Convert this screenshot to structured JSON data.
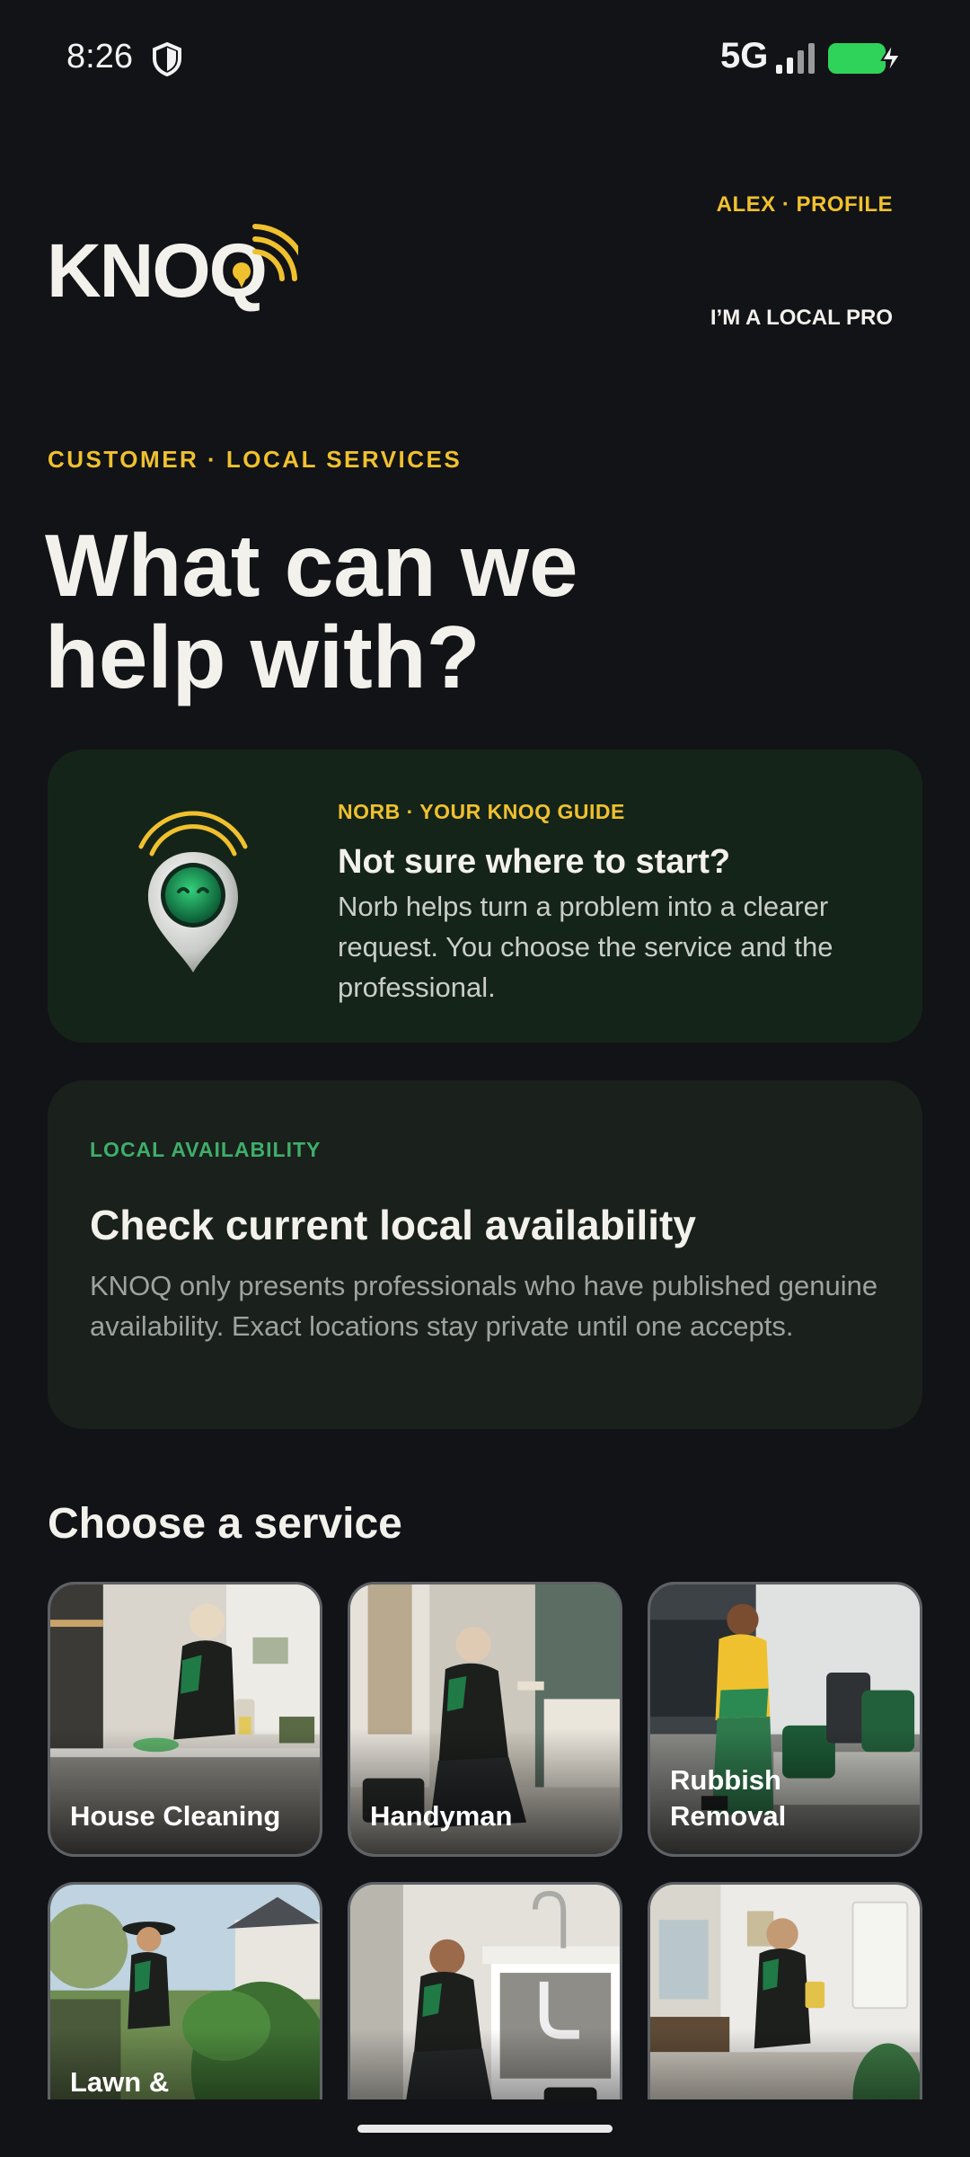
{
  "status_bar": {
    "time": "8:26",
    "network": "5G",
    "icons": [
      "shield-icon",
      "signal-icon",
      "battery-charging-icon"
    ]
  },
  "header": {
    "logo_text": "KNOQ",
    "profile_link": "ALEX · PROFILE",
    "pro_link": "I’M A LOCAL PRO"
  },
  "hero": {
    "eyebrow": "CUSTOMER · LOCAL SERVICES",
    "headline_line1": "What can we",
    "headline_line2": "help with?"
  },
  "norb_card": {
    "eyebrow": "NORB · YOUR KNOQ GUIDE",
    "title": "Not sure where to start?",
    "body": "Norb helps turn a problem into a clearer request. You choose the service and the professional."
  },
  "availability_card": {
    "eyebrow": "LOCAL AVAILABILITY",
    "title": "Check current local availability",
    "body": "KNOQ only presents professionals who have published genuine availability. Exact locations stay private until one accepts."
  },
  "services": {
    "title": "Choose a service",
    "items": [
      {
        "label": "House Cleaning"
      },
      {
        "label": "Handyman"
      },
      {
        "label": "Rubbish Removal"
      },
      {
        "label": "Lawn &"
      },
      {
        "label": ""
      },
      {
        "label": ""
      }
    ]
  },
  "colors": {
    "background": "#121317",
    "accent_yellow": "#f0c12e",
    "accent_green": "#3fae6a",
    "norb_card": "#152419",
    "availability_card": "#1a201c"
  }
}
